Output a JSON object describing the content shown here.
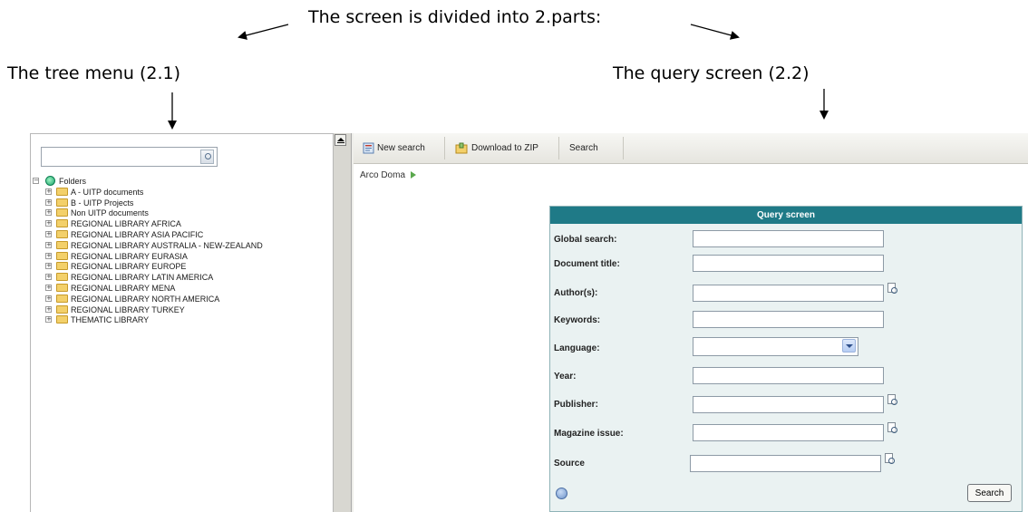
{
  "annotations": {
    "intro": "The screen is divided into 2.parts:",
    "tree_menu": "The tree menu (2.1)",
    "query_screen": "The query screen (2.2)"
  },
  "tree": {
    "search_value": "",
    "root_label": "Folders",
    "items": [
      {
        "label": "A - UITP documents"
      },
      {
        "label": "B - UITP Projects"
      },
      {
        "label": "Non UITP documents"
      },
      {
        "label": "REGIONAL LIBRARY AFRICA"
      },
      {
        "label": "REGIONAL LIBRARY ASIA PACIFIC"
      },
      {
        "label": "REGIONAL LIBRARY AUSTRALIA - NEW-ZEALAND"
      },
      {
        "label": "REGIONAL LIBRARY EURASIA"
      },
      {
        "label": "REGIONAL LIBRARY EUROPE"
      },
      {
        "label": "REGIONAL LIBRARY LATIN AMERICA"
      },
      {
        "label": "REGIONAL LIBRARY MENA"
      },
      {
        "label": "REGIONAL LIBRARY NORTH AMERICA"
      },
      {
        "label": "REGIONAL LIBRARY TURKEY"
      },
      {
        "label": "THEMATIC LIBRARY"
      }
    ]
  },
  "toolbar": {
    "new_search": "New search",
    "download_zip": "Download to ZIP",
    "search": "Search"
  },
  "breadcrumb": {
    "label": "Arco Doma"
  },
  "query": {
    "title": "Query screen",
    "fields": [
      {
        "label": "Global search:",
        "value": ""
      },
      {
        "label": "Document title:",
        "value": ""
      },
      {
        "label": "Author(s):",
        "value": ""
      },
      {
        "label": "Keywords:",
        "value": ""
      },
      {
        "label": "Language:",
        "value": ""
      },
      {
        "label": "Year:",
        "value": ""
      },
      {
        "label": "Publisher:",
        "value": ""
      },
      {
        "label": "Magazine issue:",
        "value": ""
      },
      {
        "label": "Source",
        "value": ""
      }
    ],
    "search_button": "Search"
  },
  "colors": {
    "query_header": "#1f7a87",
    "query_panel_bg": "#eaf2f2",
    "toolbar_bg": "#ecebe6"
  }
}
